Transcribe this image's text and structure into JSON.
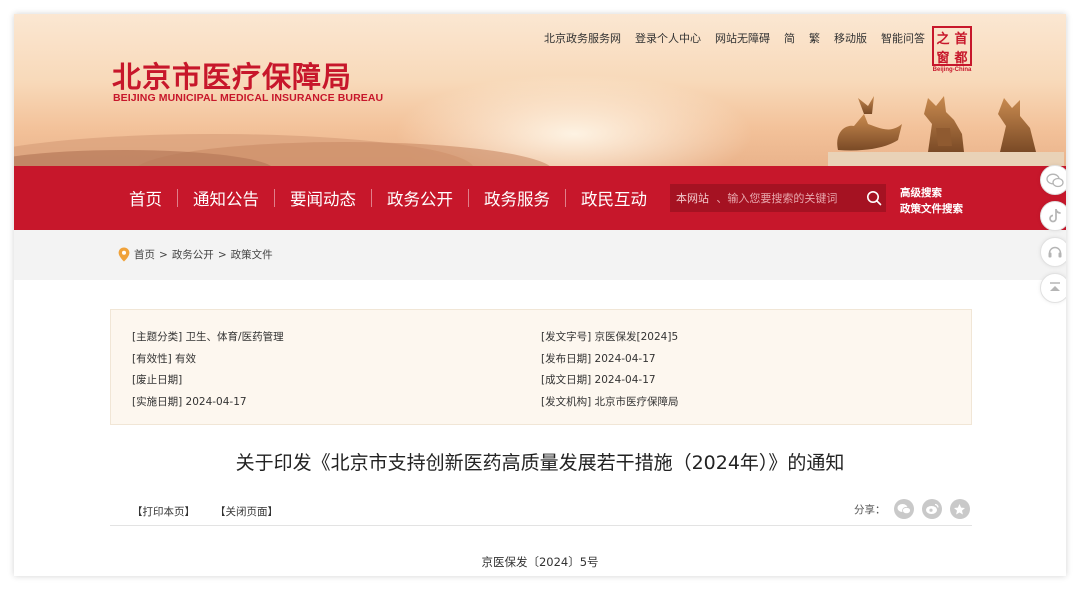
{
  "header": {
    "logo_cn": "北京市医疗保障局",
    "logo_en": "BEIJING MUNICIPAL MEDICAL INSURANCE BUREAU",
    "top_links": [
      "北京政务服务网",
      "登录个人中心",
      "网站无障碍",
      "简",
      "繁",
      "移动版",
      "智能问答"
    ],
    "seal": {
      "chars": [
        "之",
        "首",
        "窗",
        "都"
      ],
      "caption": "Beijing-China"
    }
  },
  "nav": {
    "items": [
      "首页",
      "通知公告",
      "要闻动态",
      "政务公开",
      "政务服务",
      "政民互动"
    ],
    "search": {
      "scope": "本网站",
      "placeholder": "、输入您要搜索的关键词"
    },
    "advanced": [
      "高级搜索",
      "政策文件搜索"
    ]
  },
  "breadcrumb": {
    "items": [
      "首页",
      "政务公开",
      "政策文件"
    ],
    "separator": ">"
  },
  "meta": {
    "left": [
      "[主题分类] 卫生、体育/医药管理",
      "[有效性] 有效",
      "[废止日期]",
      "[实施日期] 2024-04-17"
    ],
    "right": [
      "[发文字号] 京医保发[2024]5",
      "[发布日期] 2024-04-17",
      "[成文日期] 2024-04-17",
      "[发文机构] 北京市医疗保障局"
    ]
  },
  "article": {
    "title": "关于印发《北京市支持创新医药高质量发展若干措施（2024年）》的通知",
    "print_label": "【打印本页】",
    "close_label": "【关闭页面】",
    "share_label": "分享：",
    "doc_number": "京医保发〔2024〕5号"
  },
  "colors": {
    "brand_red": "#c7172b",
    "meta_bg": "#fdf7ef"
  }
}
